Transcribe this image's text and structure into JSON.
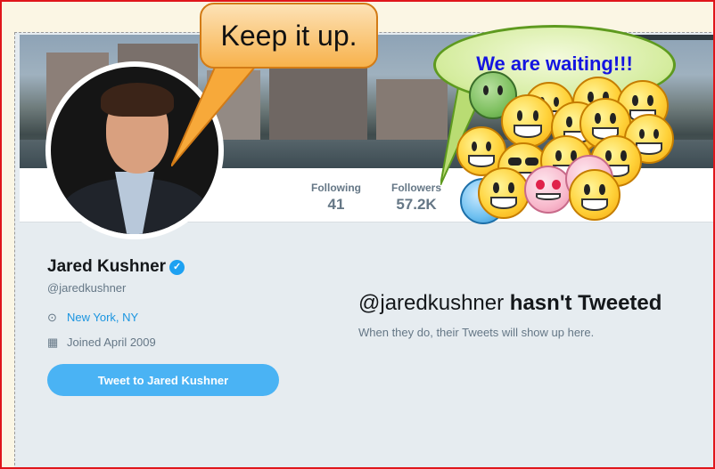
{
  "profile": {
    "name": "Jared Kushner",
    "handle": "@jaredkushner",
    "location": "New York, NY",
    "joined": "Joined April 2009",
    "verified_icon": "verified-badge-icon"
  },
  "stats": {
    "following_label": "Following",
    "following_value": "41",
    "followers_label": "Followers",
    "followers_value": "57.2K"
  },
  "actions": {
    "tweet_to_label": "Tweet to Jared Kushner"
  },
  "timeline": {
    "empty_handle": "@jaredkushner",
    "empty_title": "hasn't Tweeted",
    "empty_subtitle": "When they do, their Tweets will show up here."
  },
  "annotations": {
    "bubble_left": "Keep it up.",
    "bubble_right": "We are waiting!!!"
  },
  "colors": {
    "accent": "#1da1f2",
    "button": "#4ab3f4",
    "border": "#e0161b",
    "right_bubble_text": "#1414e0"
  }
}
